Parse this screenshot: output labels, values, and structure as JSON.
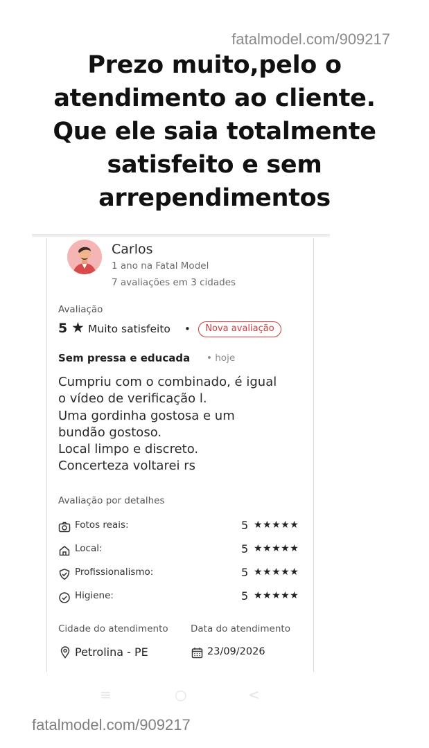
{
  "watermark": {
    "top": "fatalmodel.com/909217",
    "bottom": "fatalmodel.com/909217"
  },
  "headline": {
    "lines": [
      "Prezo muito,pelo o",
      "atendimento ao cliente.",
      "Que ele saia totalmente",
      "satisfeito e sem",
      "arrependimentos"
    ]
  },
  "reviewer": {
    "name": "Carlos",
    "member_since": "1 ano na Fatal Model",
    "reviews_count": "7 avaliações em 3 cidades",
    "avatar_icon": "user-avatar-icon"
  },
  "rating": {
    "label": "Avaliação",
    "score": "5",
    "star": "★",
    "text": "Muito satisfeito",
    "separator": "•",
    "badge": "Nova avaliação",
    "badge_color": "#c83d3d"
  },
  "review": {
    "title": "Sem pressa e educada",
    "date": "• hoje",
    "body_lines": [
      "Cumpriu com o combinado, é igual",
      "o vídeo de verificação l.",
      "Uma gordinha gostosa e um",
      "bundão gostoso.",
      "Local limpo e discreto.",
      "Concerteza voltarei rs"
    ]
  },
  "details": {
    "label": "Avaliação por detalhes",
    "items": [
      {
        "label": "Fotos reais:",
        "score": "5",
        "stars": "★★★★★",
        "icon": "camera-check-icon"
      },
      {
        "label": "Local:",
        "score": "5",
        "stars": "★★★★★",
        "icon": "home-icon"
      },
      {
        "label": "Profissionalismo:",
        "score": "5",
        "stars": "★★★★★",
        "icon": "shield-check-icon"
      },
      {
        "label": "Higiene:",
        "score": "5",
        "stars": "★★★★★",
        "icon": "check-circle-icon"
      }
    ]
  },
  "meeting": {
    "city_label": "Cidade do atendimento",
    "city_value": "Petrolina - PE",
    "date_label": "Data do atendimento",
    "date_value": "23/09/2026",
    "city_icon": "location-pin-icon",
    "date_icon": "calendar-icon"
  },
  "navbar": {
    "menu_icon": "≡",
    "home_icon": "○",
    "back_icon": "<"
  }
}
